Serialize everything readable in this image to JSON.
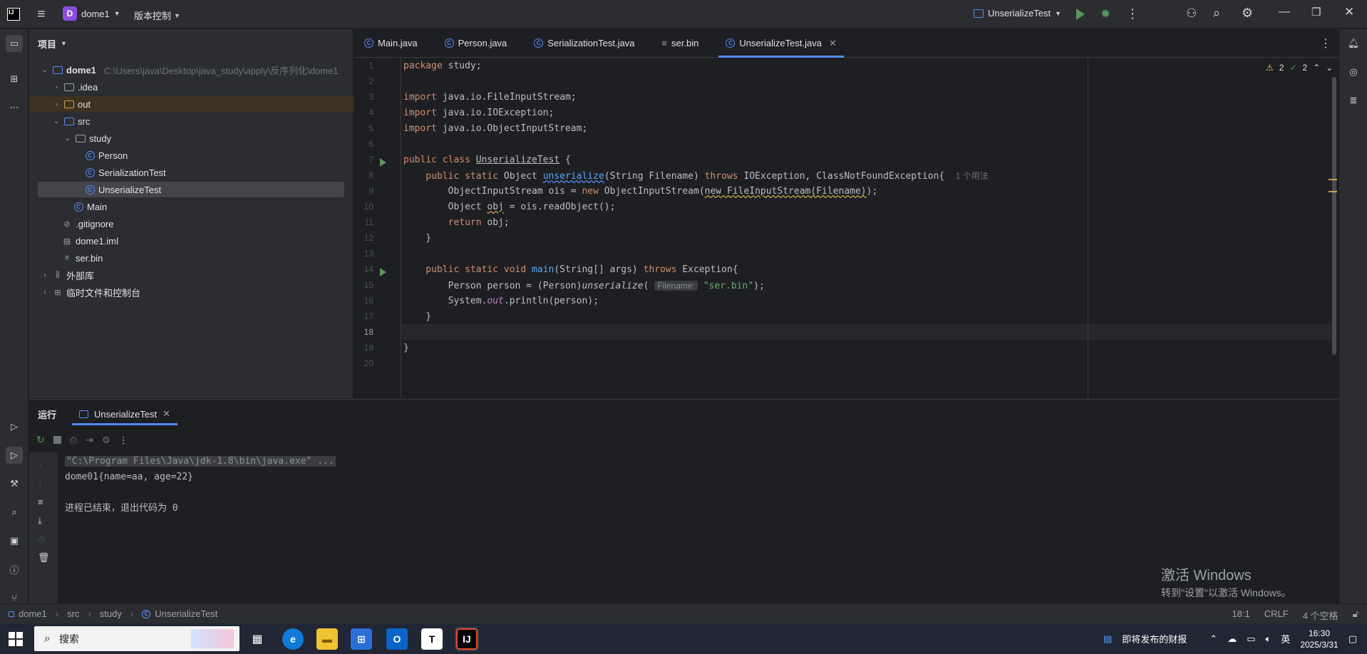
{
  "titlebar": {
    "project_badge": "D",
    "project_name": "dome1",
    "vcs_label": "版本控制",
    "run_config": "UnserializeTest"
  },
  "project_panel": {
    "title": "项目",
    "root_name": "dome1",
    "root_path": "C:\\Users\\java\\Desktop\\java_study\\apply\\反序列化\\dome1",
    "items": [
      {
        "label": ".idea"
      },
      {
        "label": "out"
      },
      {
        "label": "src"
      },
      {
        "label": "study"
      },
      {
        "label": "Person"
      },
      {
        "label": "SerializationTest"
      },
      {
        "label": "UnserializeTest"
      },
      {
        "label": "Main"
      },
      {
        "label": ".gitignore"
      },
      {
        "label": "dome1.iml"
      },
      {
        "label": "ser.bin"
      },
      {
        "label": "外部库"
      },
      {
        "label": "临时文件和控制台"
      }
    ]
  },
  "tabs": [
    {
      "label": "Main.java"
    },
    {
      "label": "Person.java"
    },
    {
      "label": "SerializationTest.java"
    },
    {
      "label": "ser.bin"
    },
    {
      "label": "UnserializeTest.java"
    }
  ],
  "editor": {
    "inspections": {
      "warnings": "2",
      "ok": "2"
    },
    "line_numbers": [
      "1",
      "2",
      "3",
      "4",
      "5",
      "6",
      "7",
      "8",
      "9",
      "10",
      "11",
      "12",
      "13",
      "14",
      "15",
      "16",
      "17",
      "18",
      "19",
      "20"
    ],
    "lines": {
      "l1_kw": "package",
      "l1_rest": " study;",
      "l3_kw": "import",
      "l3_rest": " java.io.FileInputStream;",
      "l4_kw": "import",
      "l4_rest": " java.io.IOException;",
      "l5_kw": "import",
      "l5_rest": " java.io.ObjectInputStream;",
      "l7_kw": "public class",
      "l7_name": "UnserializeTest",
      "l7_rest": " {",
      "l8_kw": "    public static",
      "l8_a": " Object ",
      "l8_fn": "unserialize",
      "l8_b": "(String Filename) ",
      "l8_kw2": "throws",
      "l8_c": " IOException, ClassNotFoundException{",
      "l8_hint": "1 个用法",
      "l9_a": "        ObjectInputStream ois = ",
      "l9_kw": "new",
      "l9_b": " ObjectInputStream(",
      "l9_squig": "new FileInputStream(Filename)",
      "l9_c": ");",
      "l10_a": "        Object ",
      "l10_var": "obj",
      "l10_b": " = ois.readObject();",
      "l11_kw": "        return",
      "l11_b": " obj;",
      "l12": "    }",
      "l14_kw": "    public static void",
      "l14_fn": " main",
      "l14_b": "(String[] args) ",
      "l14_kw2": "throws",
      "l14_c": " Exception{",
      "l15_a": "        Person person = (Person)",
      "l15_it": "unserialize",
      "l15_b": "( ",
      "l15_hint": "Filename:",
      "l15_str": " \"ser.bin\"",
      "l15_c": ");",
      "l16_a": "        System.",
      "l16_it": "out",
      "l16_b": ".println(person);",
      "l17": "    }",
      "l19": "}"
    }
  },
  "run_panel": {
    "title": "运行",
    "tab_label": "UnserializeTest",
    "console": [
      "\"C:\\Program Files\\Java\\jdk-1.8\\bin\\java.exe\" ...",
      "dome01{name=aa, age=22}",
      "",
      "进程已结束，退出代码为 0"
    ]
  },
  "watermark": {
    "line1": "激活 Windows",
    "line2": "转到\"设置\"以激活 Windows。"
  },
  "statusbar": {
    "crumbs": [
      "dome1",
      "src",
      "study",
      "UnserializeTest"
    ],
    "position": "18:1",
    "line_ending": "CRLF",
    "indent": "4 个空格"
  },
  "taskbar": {
    "search_placeholder": "搜索",
    "news": "即将发布的财报",
    "ime": "英",
    "time": "16:30",
    "date": "2025/3/31"
  },
  "colors": {
    "accent": "#548af7",
    "keyword": "#cf8e6d",
    "function": "#56a8f5",
    "string": "#6aab73",
    "run_green": "#57965c"
  }
}
